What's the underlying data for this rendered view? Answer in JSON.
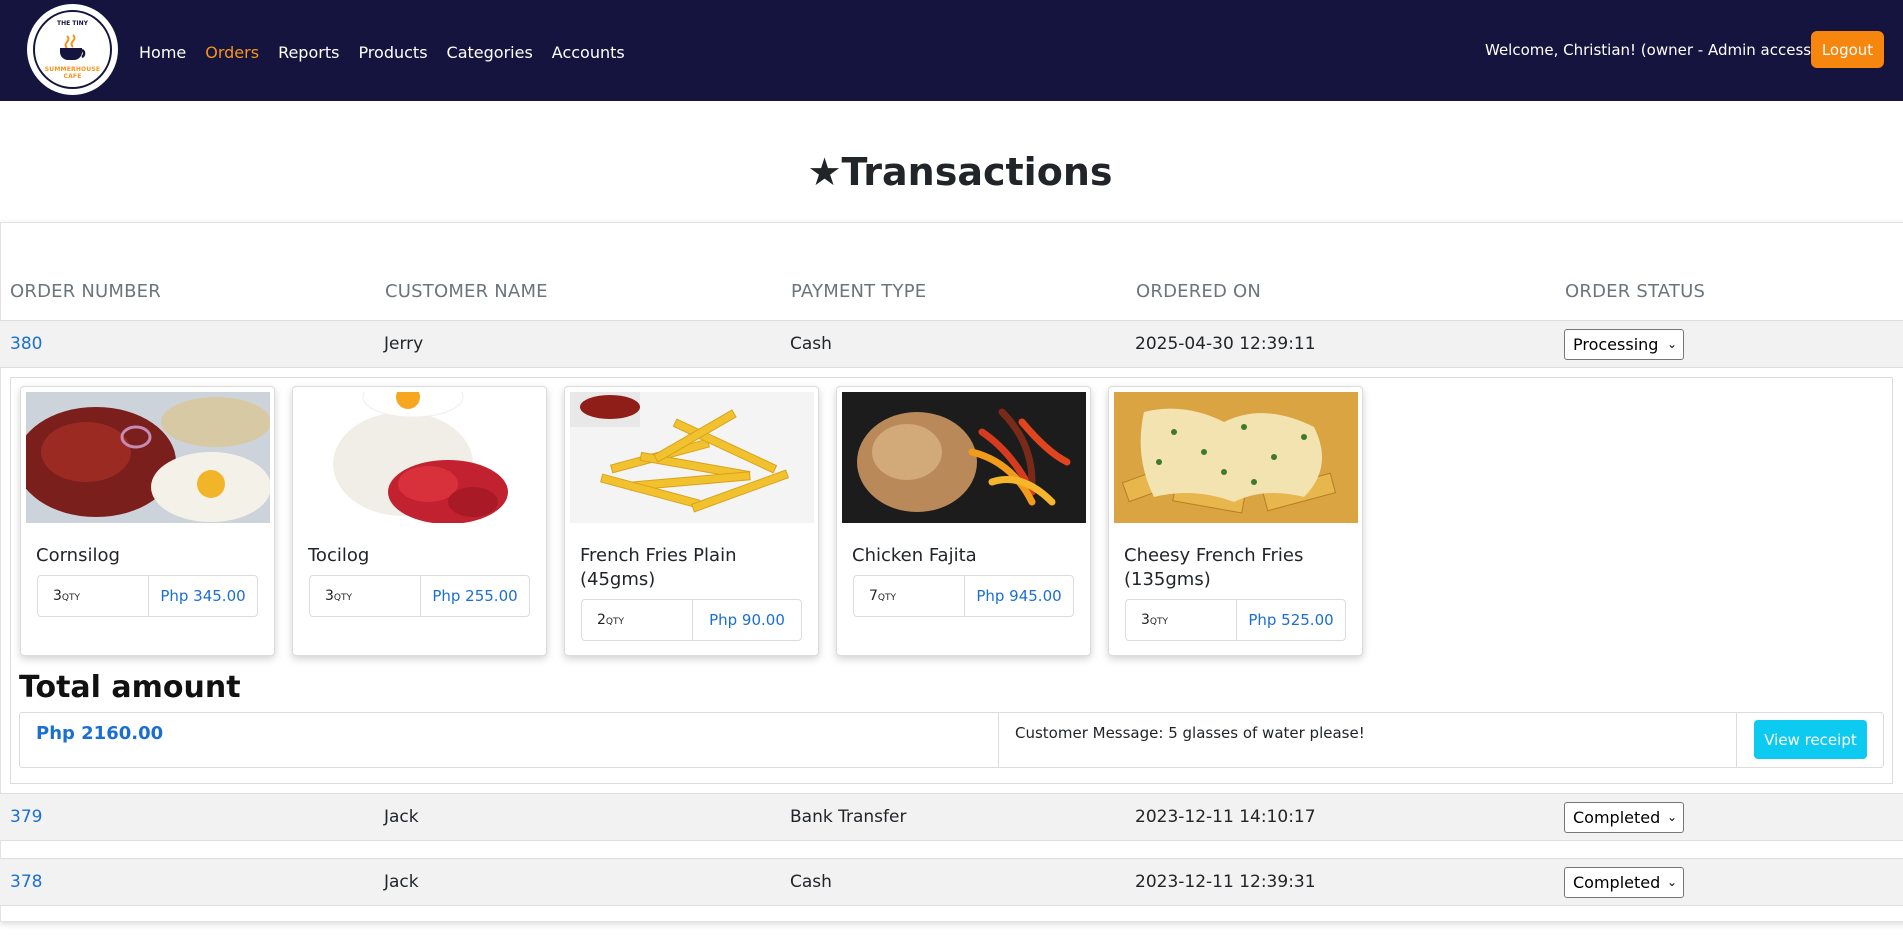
{
  "brand": {
    "logo_top": "THE TINY",
    "logo_bottom": "SUMMERHOUSE CAFE"
  },
  "nav": {
    "items": [
      {
        "label": "Home",
        "active": false
      },
      {
        "label": "Orders",
        "active": true
      },
      {
        "label": "Reports",
        "active": false
      },
      {
        "label": "Products",
        "active": false
      },
      {
        "label": "Categories",
        "active": false
      },
      {
        "label": "Accounts",
        "active": false
      }
    ],
    "welcome": "Welcome, Christian! (owner - Admin access)",
    "logout_label": "Logout"
  },
  "page": {
    "title": "★Transactions"
  },
  "table": {
    "headers": {
      "order_number": "ORDER NUMBER",
      "customer_name": "CUSTOMER NAME",
      "payment_type": "PAYMENT TYPE",
      "ordered_on": "ORDERED ON",
      "order_status": "ORDER STATUS"
    },
    "rows": [
      {
        "order_number": "380",
        "customer": "Jerry",
        "payment": "Cash",
        "ordered_on": "2025-04-30 12:39:11",
        "status": "Processing"
      },
      {
        "order_number": "379",
        "customer": "Jack",
        "payment": "Bank Transfer",
        "ordered_on": "2023-12-11 14:10:17",
        "status": "Completed"
      },
      {
        "order_number": "378",
        "customer": "Jack",
        "payment": "Cash",
        "ordered_on": "2023-12-11 12:39:31",
        "status": "Completed"
      }
    ]
  },
  "detail": {
    "qty_unit": "QTY",
    "products": [
      {
        "name": "Cornsilog",
        "qty": "3",
        "price": "Php 345.00"
      },
      {
        "name": "Tocilog",
        "qty": "3",
        "price": "Php 255.00"
      },
      {
        "name": "French Fries Plain (45gms)",
        "qty": "2",
        "price": "Php 90.00"
      },
      {
        "name": "Chicken Fajita",
        "qty": "7",
        "price": "Php 945.00"
      },
      {
        "name": "Cheesy French Fries (135gms)",
        "qty": "3",
        "price": "Php 525.00"
      }
    ],
    "total_label": "Total amount",
    "total_value": "Php 2160.00",
    "customer_message": "Customer Message: 5 glasses of water please!",
    "receipt_label": "View receipt"
  },
  "colors": {
    "navbar": "#14143e",
    "accent": "#f7941d",
    "link": "#1a6fd1",
    "receipt_button": "#0dcaf0"
  }
}
